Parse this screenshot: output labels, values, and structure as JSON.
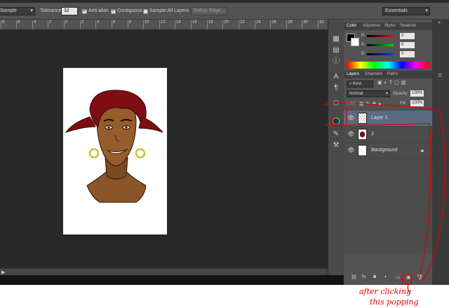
{
  "options": {
    "sample_label": "Sample",
    "tolerance_label": "Tolerance:",
    "tolerance_value": "32",
    "anti_alias_label": "Anti-alias",
    "contiguous_label": "Contiguous",
    "sample_all_layers_label": "Sample All Layers",
    "refine_edge_label": "Refine Edge...",
    "workspace_label": "Essentials"
  },
  "ruler_ticks": [
    "8",
    "6",
    "4",
    "2",
    "0",
    "2",
    "4",
    "6",
    "8",
    "10",
    "12",
    "14",
    "16",
    "18",
    "20",
    "22",
    "24",
    "26",
    "28",
    "30",
    "32"
  ],
  "color_panel": {
    "tabs": [
      "Color",
      "Adjustme",
      "Styles",
      "Swatche"
    ],
    "channels": [
      {
        "label": "R",
        "value": "0"
      },
      {
        "label": "G",
        "value": "0"
      },
      {
        "label": "B",
        "value": "0"
      }
    ]
  },
  "layers_panel": {
    "tabs": [
      "Layers",
      "Channels",
      "Paths"
    ],
    "kind_label": "Kind",
    "blend_mode": "Normal",
    "opacity_label": "Opacity:",
    "opacity_value": "100%",
    "lock_label": "Lock:",
    "fill_label": "Fill:",
    "fill_value": "100%",
    "layers": [
      {
        "name": "Layer 1",
        "selected": true
      },
      {
        "name": "3",
        "selected": false
      },
      {
        "name": "Background",
        "selected": false
      }
    ]
  },
  "annotation": {
    "line1": "after clicking",
    "line2": "this popping"
  }
}
